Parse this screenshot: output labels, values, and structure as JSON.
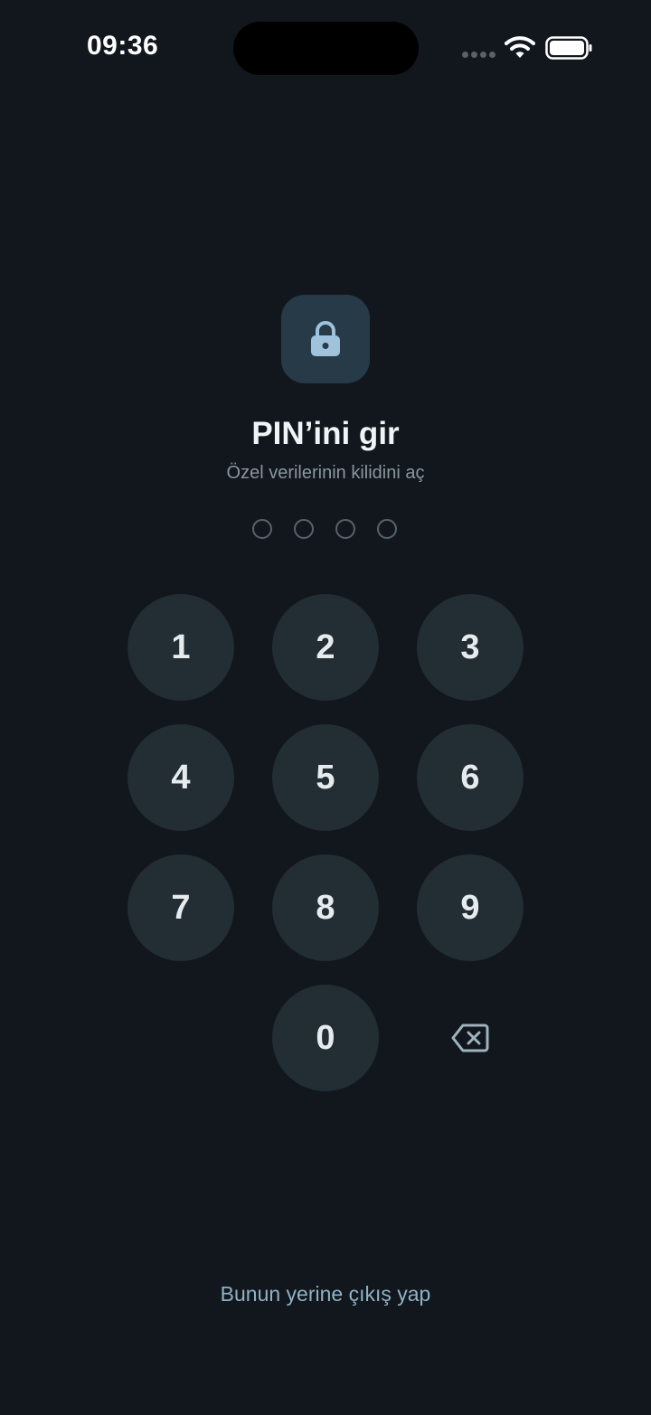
{
  "status_bar": {
    "time": "09:36",
    "icons": [
      "signal-dots-icon",
      "wifi-icon",
      "battery-icon"
    ]
  },
  "lock": {
    "icon": "lock-icon",
    "tile_color": "#273a48",
    "icon_color": "#9fc3dc"
  },
  "title": "PIN’ini gir",
  "subtitle": "Özel verilerinin kilidini aç",
  "pin": {
    "length": 4,
    "entered": 0
  },
  "keypad": {
    "keys": [
      "1",
      "2",
      "3",
      "4",
      "5",
      "6",
      "7",
      "8",
      "9",
      "0"
    ],
    "backspace_icon": "backspace-icon"
  },
  "signout_label": "Bunun yerine çıkış yap",
  "colors": {
    "background": "#11171c",
    "key_background": "#222d34",
    "link": "#8fb2c6"
  }
}
